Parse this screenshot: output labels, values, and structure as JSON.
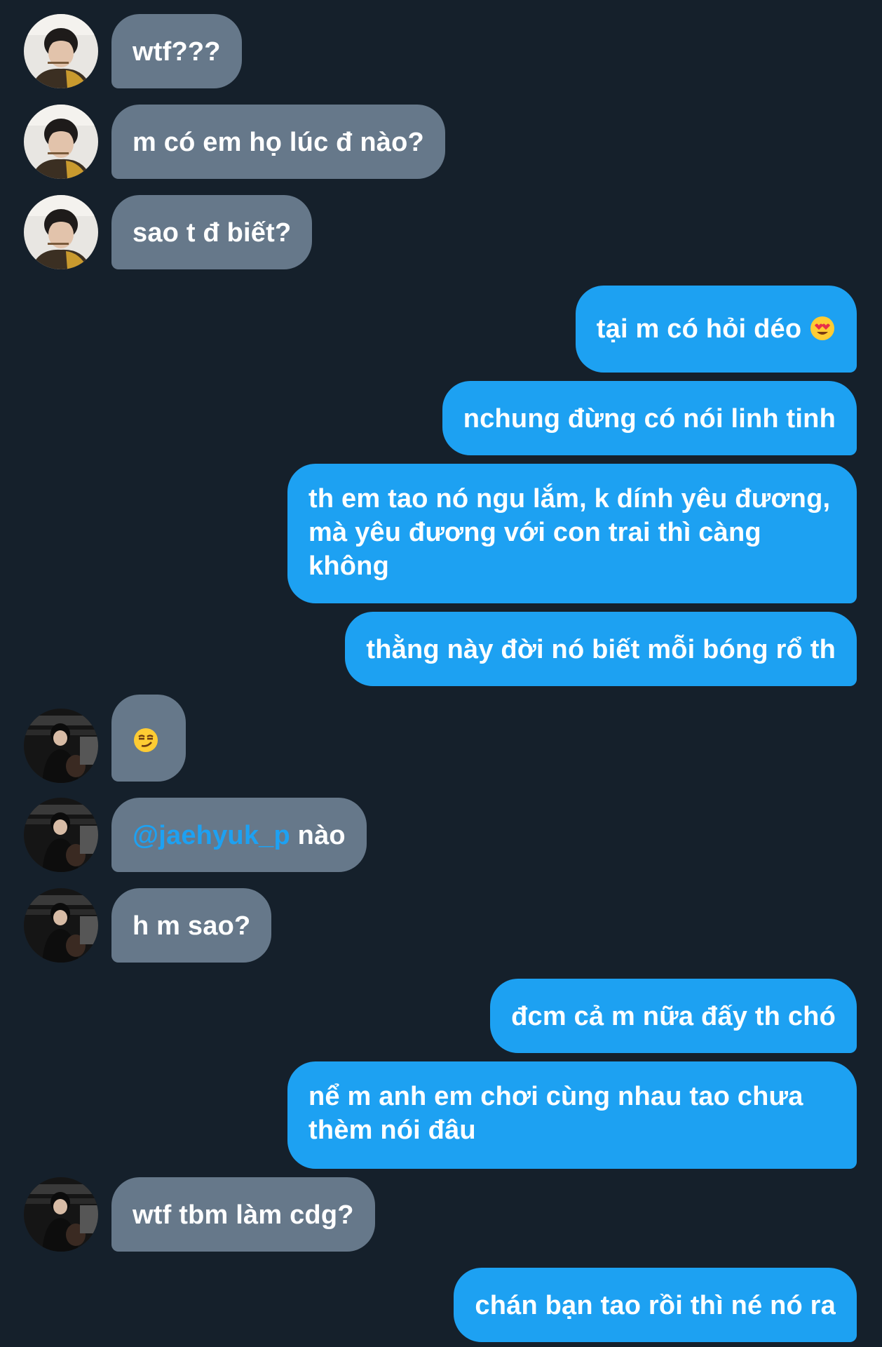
{
  "messages": [
    {
      "dir": "in",
      "avatar": "a",
      "text": "wtf???"
    },
    {
      "dir": "in",
      "avatar": "a",
      "text": "m có em họ lúc đ nào?"
    },
    {
      "dir": "in",
      "avatar": "a",
      "text": "sao t đ biết?"
    },
    {
      "dir": "out",
      "text": "tại m có hỏi déo",
      "emoji": "heart-eyes-emoji"
    },
    {
      "dir": "out",
      "text": "nchung đừng có nói linh tinh"
    },
    {
      "dir": "out",
      "text": "th em tao nó ngu lắm, k dính yêu đương, mà yêu đương với con trai thì càng không"
    },
    {
      "dir": "out",
      "text": "thằng này đời nó biết mỗi bóng rổ th"
    },
    {
      "dir": "in",
      "avatar": "b",
      "emoji": "smirk-emoji"
    },
    {
      "dir": "in",
      "avatar": "b",
      "mention": "@jaehyuk_p",
      "text": " nào"
    },
    {
      "dir": "in",
      "avatar": "b",
      "text": "h m sao?"
    },
    {
      "dir": "out",
      "text": "đcm cả m nữa đấy th chó"
    },
    {
      "dir": "out",
      "text": "nể m anh em chơi cùng nhau tao chưa thèm nói đâu"
    },
    {
      "dir": "in",
      "avatar": "b",
      "text": "wtf tbm làm cdg?"
    },
    {
      "dir": "out",
      "text": "chán bạn tao rồi thì né nó ra"
    }
  ],
  "colors": {
    "background": "#15202b",
    "incoming_bubble": "#66788a",
    "outgoing_bubble": "#1da1f2",
    "mention": "#1da1f2"
  }
}
